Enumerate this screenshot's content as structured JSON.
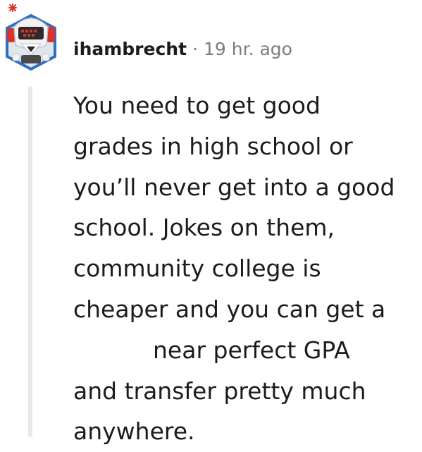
{
  "comment": {
    "author": "ihambrecht",
    "separator": "·",
    "timestamp": "19 hr. ago",
    "body_lines": [
      "You need to get good",
      "grades in high school or",
      "you’ll never get into a good",
      "school. Jokes on them,",
      "community college is",
      "cheaper and you can get a",
      "near perfect GPA",
      "and transfer pretty much",
      "anywhere."
    ]
  },
  "avatar": {
    "icon": "robot-avatar-icon",
    "colors": {
      "hex_border": "#2e6fc4",
      "hex_fill": "#dfe6ec",
      "helmet": "#f2f2f2",
      "accent_red": "#d9342b",
      "visor": "#2b2b2b"
    }
  },
  "colors": {
    "text": "#1c1c1c",
    "meta_text": "#7c7c7c",
    "thread_line": "#e9e9eb"
  }
}
